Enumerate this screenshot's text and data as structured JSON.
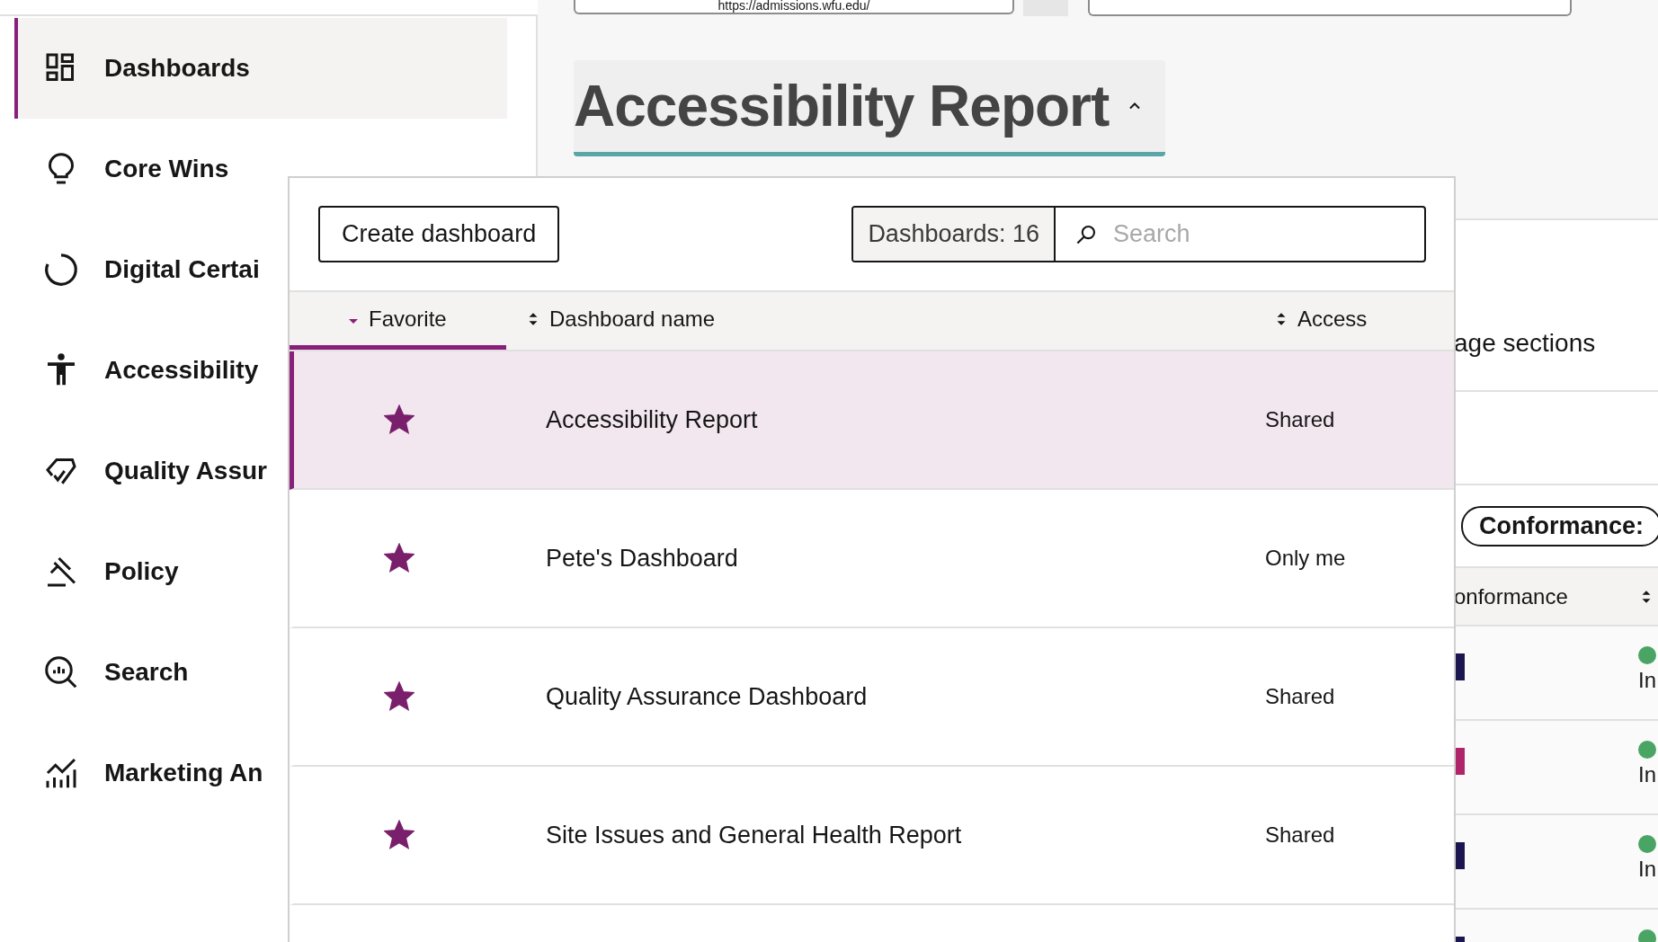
{
  "sidebar": {
    "items": [
      {
        "label": "Dashboards",
        "selected": true
      },
      {
        "label": "Core Wins",
        "selected": false
      },
      {
        "label": "Digital Certai",
        "selected": false
      },
      {
        "label": "Accessibility",
        "selected": false
      },
      {
        "label": "Quality Assur",
        "selected": false
      },
      {
        "label": "Policy",
        "selected": false
      },
      {
        "label": "Search",
        "selected": false
      },
      {
        "label": "Marketing An",
        "selected": false
      }
    ]
  },
  "header": {
    "url": "https://admissions.wfu.edu/",
    "title": "Accessibility Report",
    "expanded": true
  },
  "background_page": {
    "section_label": "age sections",
    "filter_pill": "Conformance:",
    "column_header": "onformance",
    "rows": [
      {
        "color": "#1b1650",
        "status": "In"
      },
      {
        "color": "#b0246a",
        "status": "In"
      },
      {
        "color": "#1b1650",
        "status": "In"
      },
      {
        "color": "#1b1650",
        "status": ""
      }
    ]
  },
  "dashboard_menu": {
    "create_button": "Create dashboard",
    "count": "Dashboards: 16",
    "search": {
      "placeholder": "Search"
    },
    "columns": [
      {
        "label": "Favorite",
        "selected": true
      },
      {
        "label": "Dashboard name",
        "selected": false
      },
      {
        "label": "Access",
        "selected": false
      }
    ],
    "rows": [
      {
        "favorite": true,
        "name": "Accessibility Report",
        "access": "Shared",
        "selected": true
      },
      {
        "favorite": true,
        "name": "Pete's Dashboard",
        "access": "Only me",
        "selected": false
      },
      {
        "favorite": true,
        "name": "Quality Assurance Dashboard",
        "access": "Shared",
        "selected": false
      },
      {
        "favorite": true,
        "name": "Site Issues and General Health Report",
        "access": "Shared",
        "selected": false
      }
    ]
  }
}
